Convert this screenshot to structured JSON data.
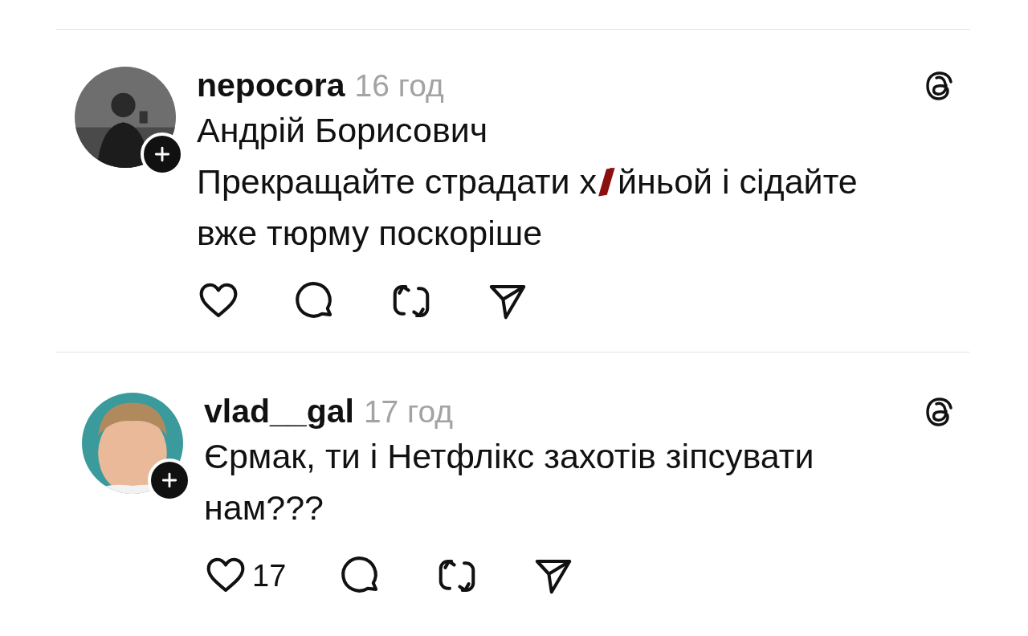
{
  "posts": [
    {
      "username": "nepocora",
      "time": "16 год",
      "lines": [
        [
          {
            "kind": "text",
            "text": "Андрій Борисович"
          }
        ],
        [
          {
            "kind": "text",
            "text": "Прекращайте страдати х"
          },
          {
            "kind": "censor",
            "color": "#8b1010"
          },
          {
            "kind": "text",
            "text": "йньой і сідайте"
          }
        ],
        [
          {
            "kind": "text",
            "text": "вже тюрму поскоріше"
          }
        ]
      ]
    },
    {
      "username": "vlad__gal",
      "time": "17 год",
      "likes": "17",
      "lines": [
        [
          {
            "kind": "text",
            "text": "Єрмак, ти і Нетфлікс захотів зіпсувати"
          }
        ],
        [
          {
            "kind": "text",
            "text": "нам???"
          }
        ]
      ]
    }
  ]
}
